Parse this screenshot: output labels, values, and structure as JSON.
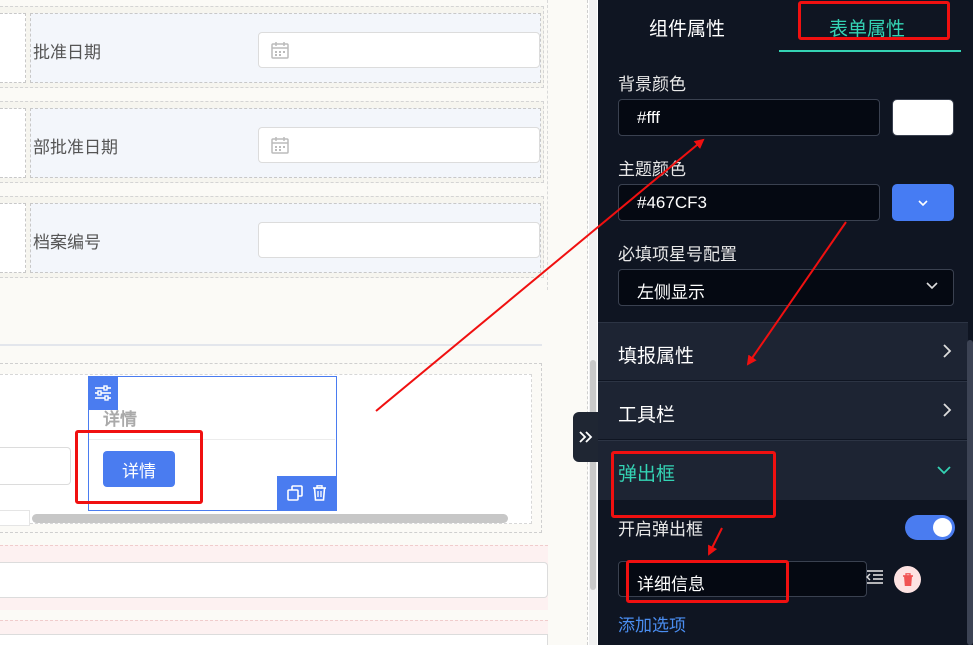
{
  "form": {
    "fields": [
      {
        "label": "批准日期",
        "type": "date"
      },
      {
        "label": "部批准日期",
        "type": "date"
      },
      {
        "label": "档案编号",
        "type": "text"
      }
    ]
  },
  "subtable": {
    "column_header": "详情",
    "detail_button": "详情"
  },
  "panel": {
    "tabs": {
      "component": "组件属性",
      "form": "表单属性"
    },
    "bg_color_label": "背景颜色",
    "bg_color_value": "#fff",
    "theme_color_label": "主题颜色",
    "theme_color_value": "#467CF3",
    "required_star_label": "必填项星号配置",
    "required_star_value": "左侧显示",
    "sections": {
      "fill": "填报属性",
      "toolbar": "工具栏",
      "popup": "弹出框"
    },
    "popup": {
      "enable_label": "开启弹出框",
      "enabled": true,
      "option_value": "详细信息",
      "add_option": "添加选项"
    }
  },
  "colors": {
    "accent": "#34d3b4",
    "primary": "#467CF3",
    "panel_bg": "#0f1522",
    "annotation": "#f01010"
  }
}
